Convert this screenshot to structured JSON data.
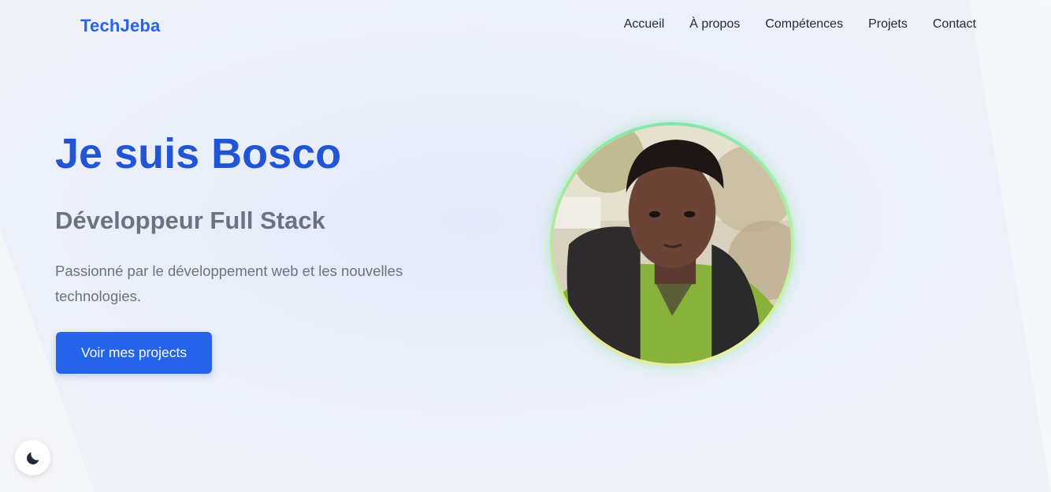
{
  "brand": {
    "logo_text": "TechJeba",
    "accent": "#2563eb"
  },
  "nav": {
    "items": [
      {
        "label": "Accueil"
      },
      {
        "label": "À propos"
      },
      {
        "label": "Compétences"
      },
      {
        "label": "Projets"
      },
      {
        "label": "Contact"
      }
    ]
  },
  "hero": {
    "title": "Je suis Bosco",
    "subtitle": "Développeur Full Stack",
    "description": "Passionné par le développement web et les nouvelles technologies.",
    "cta_label": "Voir mes projects"
  },
  "profile": {
    "alt": "profile-photo"
  },
  "theme_toggle": {
    "icon": "moon-icon"
  }
}
